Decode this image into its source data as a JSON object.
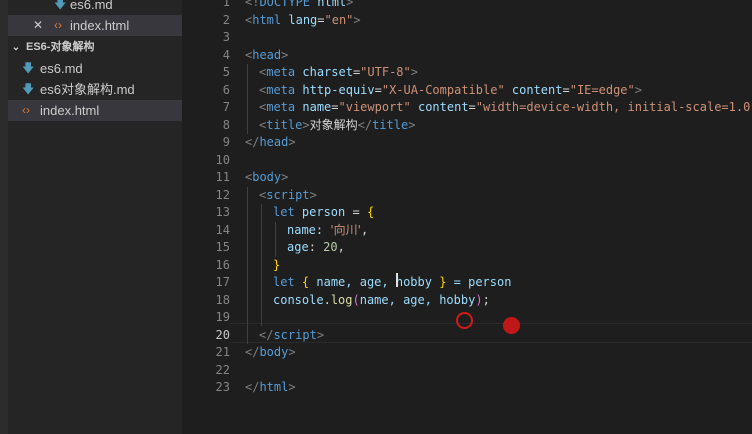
{
  "explorer": {
    "items": [
      {
        "label": "es6.md",
        "icon": "markdown-icon"
      },
      {
        "label": "index.html",
        "icon": "html-file-icon",
        "active": true
      },
      {
        "label": "ES6-对象解构",
        "icon": "chevron-down-icon"
      },
      {
        "label": "es6.md",
        "icon": "markdown-icon"
      },
      {
        "label": "es6对象解构.md",
        "icon": "markdown-icon"
      },
      {
        "label": "index.html",
        "icon": "html-file-icon"
      }
    ]
  },
  "editor": {
    "line_numbers": [
      "1",
      "2",
      "3",
      "4",
      "5",
      "6",
      "7",
      "8",
      "9",
      "10",
      "11",
      "12",
      "13",
      "14",
      "15",
      "16",
      "17",
      "18",
      "19",
      "20",
      "21",
      "22",
      "23"
    ],
    "current_line": "20",
    "lines": {
      "l1": {
        "a": "<!",
        "b": "DOCTYPE",
        "c": " html",
        "d": ">"
      },
      "l2": {
        "a": "<",
        "b": "html",
        "c": " lang",
        "d": "=",
        "e": "\"en\"",
        "f": ">"
      },
      "l4": {
        "a": "<",
        "b": "head",
        "c": ">"
      },
      "l5": {
        "a": "<",
        "b": "meta",
        "c": " charset",
        "d": "=",
        "e": "\"UTF-8\"",
        "f": ">"
      },
      "l6": {
        "a": "<",
        "b": "meta",
        "c": " http-equiv",
        "d": "=",
        "e": "\"X-UA-Compatible\"",
        "f": " content",
        "g": "=",
        "h": "\"IE=edge\"",
        "i": ">"
      },
      "l7": {
        "a": "<",
        "b": "meta",
        "c": " name",
        "d": "=",
        "e": "\"viewport\"",
        "f": " content",
        "g": "=",
        "h": "\"width=device-width, initial-scale=1.0\"",
        "i": ">"
      },
      "l8": {
        "a": "<",
        "b": "title",
        "c": ">",
        "d": "对象解构",
        "e": "</",
        "f": "title",
        "g": ">"
      },
      "l9": {
        "a": "</",
        "b": "head",
        "c": ">"
      },
      "l11": {
        "a": "<",
        "b": "body",
        "c": ">"
      },
      "l12": {
        "a": "<",
        "b": "script",
        "c": ">"
      },
      "l13": {
        "a": "let",
        "b": " person",
        "c": " = ",
        "d": "{"
      },
      "l14": {
        "a": "name",
        "b": ": ",
        "c": "'向川'",
        "d": ","
      },
      "l15": {
        "a": "age",
        "b": ": ",
        "c": "20",
        "d": ","
      },
      "l16": {
        "a": "}"
      },
      "l17": {
        "a": "let",
        "b": " ",
        "c": "{",
        "d": " name, age, hobby ",
        "e": "}",
        "f": " = person"
      },
      "l18": {
        "a": "console",
        "b": ".",
        "c": "log",
        "d": "(",
        "e": "name, age, hobby",
        "f": ")",
        "g": ";"
      },
      "l20": {
        "a": "</",
        "b": "script",
        "c": ">"
      },
      "l21": {
        "a": "</",
        "b": "body",
        "c": ">"
      },
      "l23": {
        "a": "</",
        "b": "html",
        "c": ">"
      }
    }
  }
}
